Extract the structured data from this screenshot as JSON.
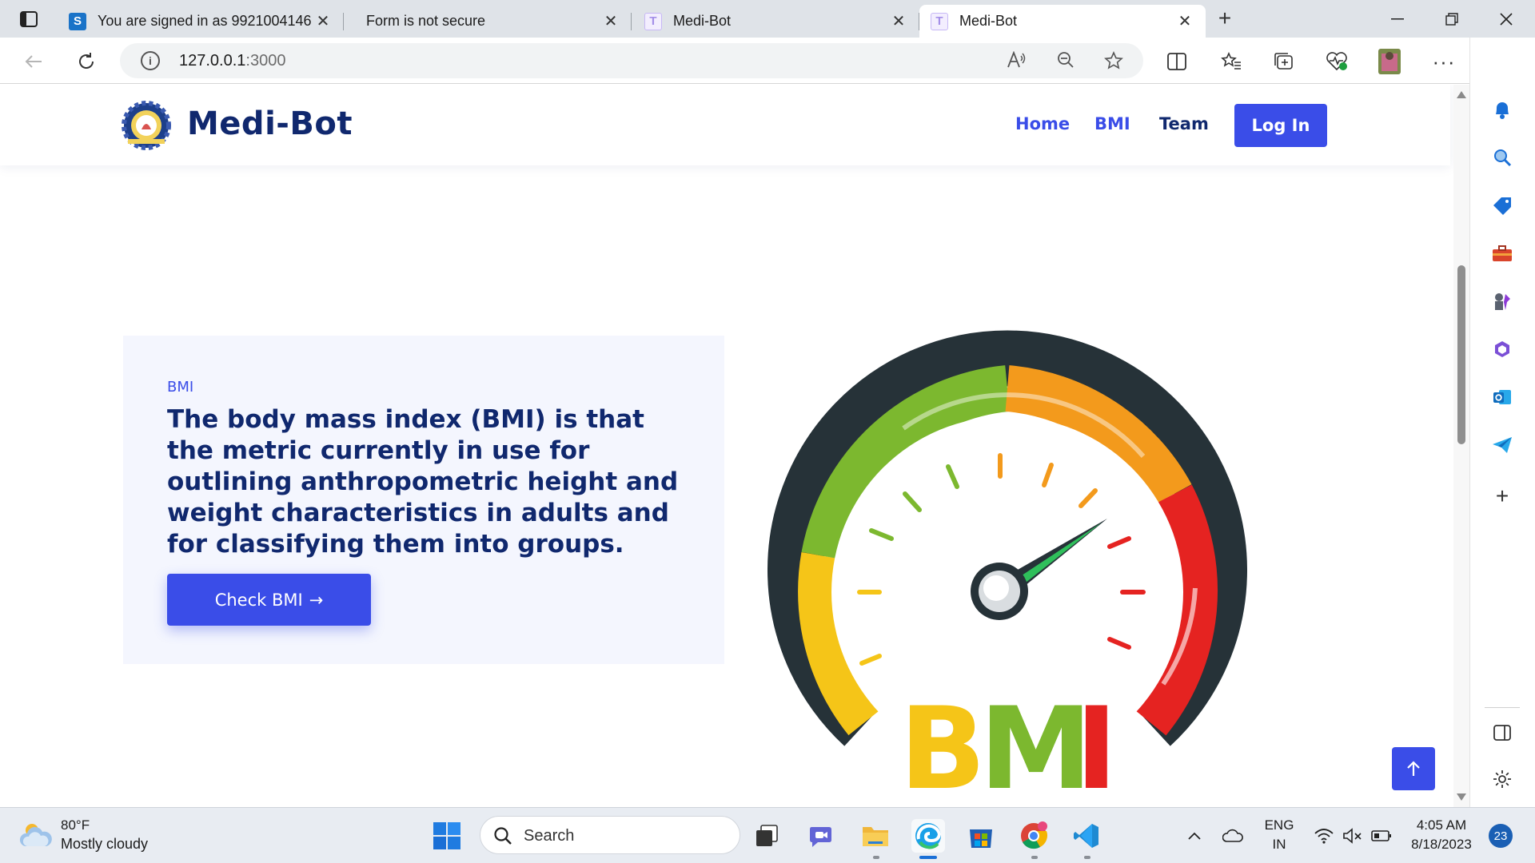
{
  "browser": {
    "tabs": [
      {
        "title": "You are signed in as 9921004146",
        "favicon": "S",
        "favicon_color": "#1a73c8",
        "active": false
      },
      {
        "title": "Form is not secure",
        "favicon": "",
        "favicon_color": "",
        "active": false
      },
      {
        "title": "Medi-Bot",
        "favicon": "T",
        "favicon_color": "#c7b8f5",
        "active": false
      },
      {
        "title": "Medi-Bot",
        "favicon": "T",
        "favicon_color": "#c7b8f5",
        "active": true
      }
    ],
    "close_glyph": "✕",
    "new_tab_glyph": "+",
    "url_host": "127.0.0.1",
    "url_port": ":3000",
    "url_info_glyph": "i"
  },
  "site": {
    "brand": "Medi-Bot",
    "nav": [
      {
        "label": "Home",
        "color": "#3a4de8"
      },
      {
        "label": "BMI",
        "color": "#3a4de8"
      },
      {
        "label": "Team",
        "color": "#10286e"
      }
    ],
    "login_label": "Log In",
    "hero": {
      "eyebrow": "BMI",
      "text": "The body mass index (BMI) is that the metric currently in use for outlining anthropometric height and weight characteristics in adults and for classifying them into groups.",
      "button_label": "Check BMI",
      "button_arrow": "→"
    },
    "gauge_letters": [
      "B",
      "M",
      "I"
    ],
    "colors": {
      "primary": "#3a4de8",
      "heading": "#10286e",
      "card_bg": "#f4f6fe"
    }
  },
  "taskbar": {
    "weather_temp": "80°F",
    "weather_desc": "Mostly cloudy",
    "search_label": "Search",
    "lang_top": "ENG",
    "lang_bottom": "IN",
    "time": "4:05 AM",
    "date": "8/18/2023",
    "notifications": "23"
  }
}
